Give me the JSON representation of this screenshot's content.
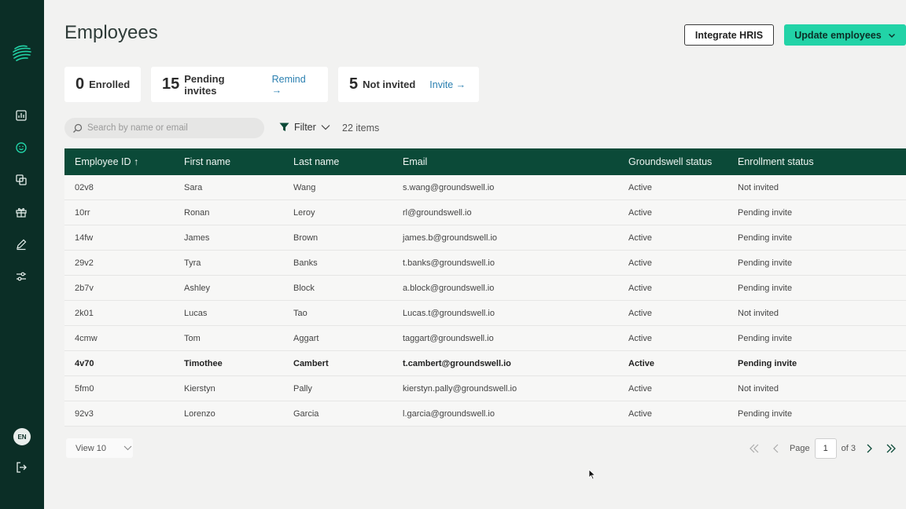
{
  "sidebar": {
    "logo": "groundswell-logo-icon",
    "nav": [
      {
        "icon": "bar-chart-icon"
      },
      {
        "icon": "smiley-icon",
        "active": true
      },
      {
        "icon": "copy-icon"
      },
      {
        "icon": "gift-icon"
      },
      {
        "icon": "pencil-icon"
      },
      {
        "icon": "sliders-icon"
      }
    ],
    "language": "EN",
    "logout_icon": "logout-icon"
  },
  "header": {
    "title": "Employees",
    "integrate_label": "Integrate HRIS",
    "update_label": "Update employees"
  },
  "stats": [
    {
      "value": "0",
      "label": "Enrolled",
      "action": ""
    },
    {
      "value": "15",
      "label": "Pending invites",
      "action": "Remind →"
    },
    {
      "value": "5",
      "label": "Not invited",
      "action": "Invite →"
    }
  ],
  "toolbar": {
    "search_placeholder": "Search by name or email",
    "filter_label": "Filter",
    "items_count": "22 items"
  },
  "table": {
    "columns": [
      "Employee ID ↑",
      "First name",
      "Last name",
      "Email",
      "Groundswell status",
      "Enrollment status"
    ],
    "rows": [
      [
        "02v8",
        "Sara",
        "Wang",
        "s.wang@groundswell.io",
        "Active",
        "Not invited"
      ],
      [
        "10rr",
        "Ronan",
        "Leroy",
        "rl@groundswell.io",
        "Active",
        "Pending invite"
      ],
      [
        "14fw",
        "James",
        "Brown",
        "james.b@groundswell.io",
        "Active",
        "Pending invite"
      ],
      [
        "29v2",
        "Tyra",
        "Banks",
        "t.banks@groundswell.io",
        "Active",
        "Pending invite"
      ],
      [
        "2b7v",
        "Ashley",
        "Block",
        "a.block@groundswell.io",
        "Active",
        "Pending invite"
      ],
      [
        "2k01",
        "Lucas",
        "Tao",
        "Lucas.t@groundswell.io",
        "Active",
        "Not invited"
      ],
      [
        "4cmw",
        "Tom",
        "Aggart",
        "taggart@groundswell.io",
        "Active",
        "Pending invite"
      ],
      [
        "4v70",
        "Timothee",
        "Cambert",
        "t.cambert@groundswell.io",
        "Active",
        "Pending invite"
      ],
      [
        "5fm0",
        "Kierstyn",
        "Pally",
        "kierstyn.pally@groundswell.io",
        "Active",
        "Not invited"
      ],
      [
        "92v3",
        "Lorenzo",
        "Garcia",
        "l.garcia@groundswell.io",
        "Active",
        "Pending invite"
      ]
    ],
    "highlighted_row": 7
  },
  "footer": {
    "view_label": "View 10",
    "page_label": "Page",
    "page_value": "1",
    "of_label": "of 3"
  },
  "colors": {
    "sidebar": "#0b2e26",
    "table_header": "#0b4a38",
    "accent": "#22d3a7",
    "link": "#2a7fb0"
  }
}
